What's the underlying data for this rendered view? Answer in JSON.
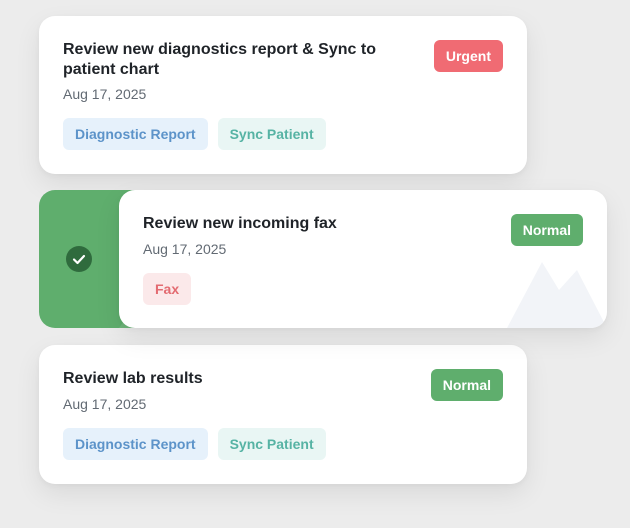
{
  "tasks": [
    {
      "title": "Review new diagnostics report & Sync to patient chart",
      "date": "Aug 17, 2025",
      "priority": "Urgent",
      "tags": [
        "Diagnostic Report",
        "Sync Patient"
      ]
    },
    {
      "title": "Review new incoming fax",
      "date": "Aug 17, 2025",
      "priority": "Normal",
      "tags": [
        "Fax"
      ]
    },
    {
      "title": "Review lab results",
      "date": "Aug 17, 2025",
      "priority": "Normal",
      "tags": [
        "Diagnostic Report",
        "Sync Patient"
      ]
    }
  ],
  "swipe_action": {
    "icon": "check-circle-icon",
    "color": "#5fae6d"
  },
  "colors": {
    "urgent": "#f06b73",
    "normal": "#5fae6d",
    "tag_blue_bg": "#e6f1fb",
    "tag_blue_text": "#5c93c9",
    "tag_teal_bg": "#e9f6f4",
    "tag_teal_text": "#56b3a4",
    "tag_red_bg": "#fbe9ea",
    "tag_red_text": "#e36b71"
  }
}
